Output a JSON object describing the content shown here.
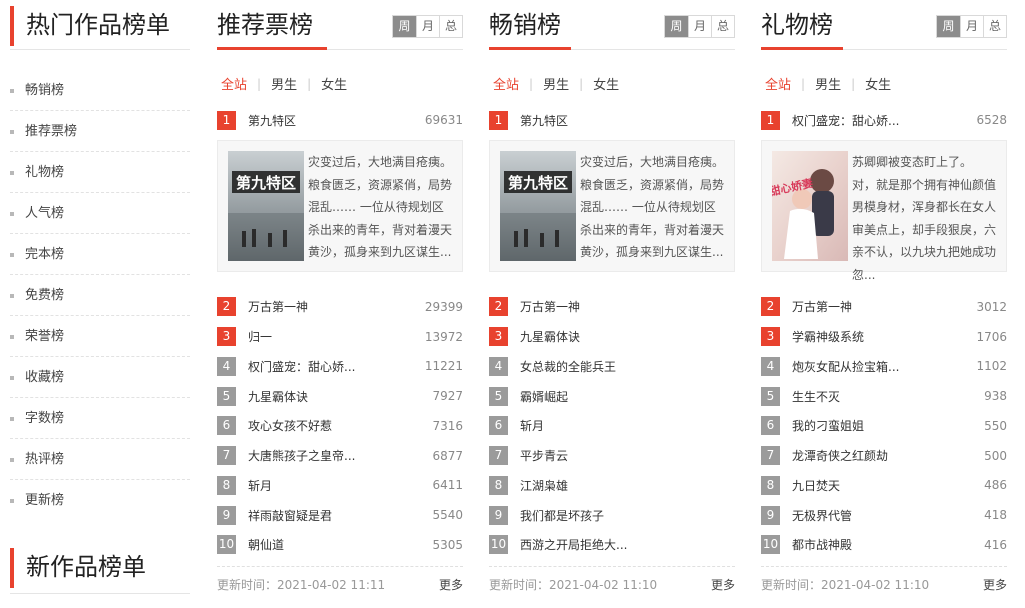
{
  "sidebar": {
    "title": "热门作品榜单",
    "items": [
      "畅销榜",
      "推荐票榜",
      "礼物榜",
      "人气榜",
      "完本榜",
      "免费榜",
      "荣誉榜",
      "收藏榜",
      "字数榜",
      "热评榜",
      "更新榜"
    ],
    "title2": "新作品榜单"
  },
  "periods": [
    "周",
    "月",
    "总"
  ],
  "filters": [
    "全站",
    "男生",
    "女生"
  ],
  "more_label": "更多",
  "colors": {
    "accent": "#e8422e",
    "rank_other": "#9b9b9b"
  },
  "panels": [
    {
      "title": "推荐票榜",
      "first": {
        "rank": "1",
        "name": "第九特区",
        "num": "69631"
      },
      "cover_title": "第九特区",
      "blurb": "灾变过后，大地满目疮痍。 粮食匮乏，资源紧俏，局势混乱…… 一位从待规划区杀出来的青年，背对着漫天黄沙，孤身来到九区谋生...",
      "list": [
        {
          "rank": "2",
          "name": "万古第一神",
          "num": "29399"
        },
        {
          "rank": "3",
          "name": "归一",
          "num": "13972"
        },
        {
          "rank": "4",
          "name": "权门盛宠：甜心娇...",
          "num": "11221"
        },
        {
          "rank": "5",
          "name": "九星霸体诀",
          "num": "7927"
        },
        {
          "rank": "6",
          "name": "攻心女孩不好惹",
          "num": "7316"
        },
        {
          "rank": "7",
          "name": "大唐熊孩子之皇帝...",
          "num": "6877"
        },
        {
          "rank": "8",
          "name": "斩月",
          "num": "6411"
        },
        {
          "rank": "9",
          "name": "祥雨敲窗疑是君",
          "num": "5540"
        },
        {
          "rank": "10",
          "name": "朝仙道",
          "num": "5305"
        }
      ],
      "update": "更新时间：2021-04-02 11:11"
    },
    {
      "title": "畅销榜",
      "first": {
        "rank": "1",
        "name": "第九特区",
        "num": ""
      },
      "cover_title": "第九特区",
      "blurb": "灾变过后，大地满目疮痍。 粮食匮乏，资源紧俏，局势混乱…… 一位从待规划区杀出来的青年，背对着漫天黄沙，孤身来到九区谋生...",
      "list": [
        {
          "rank": "2",
          "name": "万古第一神",
          "num": ""
        },
        {
          "rank": "3",
          "name": "九星霸体诀",
          "num": ""
        },
        {
          "rank": "4",
          "name": "女总裁的全能兵王",
          "num": ""
        },
        {
          "rank": "5",
          "name": "霸婿崛起",
          "num": ""
        },
        {
          "rank": "6",
          "name": "斩月",
          "num": ""
        },
        {
          "rank": "7",
          "name": "平步青云",
          "num": ""
        },
        {
          "rank": "8",
          "name": "江湖枭雄",
          "num": ""
        },
        {
          "rank": "9",
          "name": "我们都是坏孩子",
          "num": ""
        },
        {
          "rank": "10",
          "name": "西游之开局拒绝大...",
          "num": ""
        }
      ],
      "update": "更新时间：2021-04-02 11:10"
    },
    {
      "title": "礼物榜",
      "first": {
        "rank": "1",
        "name": "权门盛宠：甜心娇...",
        "num": "6528"
      },
      "cover_title": "甜心娇妻",
      "blurb": "苏卿卿被变态盯上了。 对，就是那个拥有神仙颜值男模身材，浑身都长在女人审美点上，却手段狠戾，六亲不认，以九块九把她成功忽...",
      "list": [
        {
          "rank": "2",
          "name": "万古第一神",
          "num": "3012"
        },
        {
          "rank": "3",
          "name": "学霸神级系统",
          "num": "1706"
        },
        {
          "rank": "4",
          "name": "炮灰女配从捡宝箱...",
          "num": "1102"
        },
        {
          "rank": "5",
          "name": "生生不灭",
          "num": "938"
        },
        {
          "rank": "6",
          "name": "我的刁蛮姐姐",
          "num": "550"
        },
        {
          "rank": "7",
          "name": "龙潭奇侠之红颜劫",
          "num": "500"
        },
        {
          "rank": "8",
          "name": "九日焚天",
          "num": "486"
        },
        {
          "rank": "9",
          "name": "无极界代管",
          "num": "418"
        },
        {
          "rank": "10",
          "name": "都市战神殿",
          "num": "416"
        }
      ],
      "update": "更新时间：2021-04-02 11:10"
    }
  ]
}
